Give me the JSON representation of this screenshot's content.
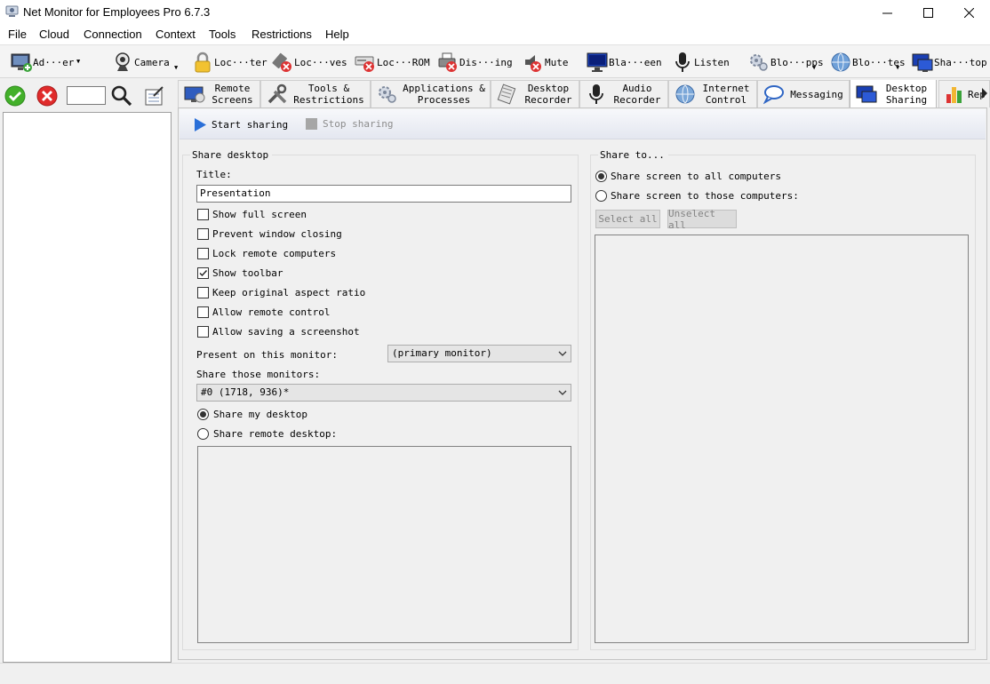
{
  "window": {
    "title": "Net Monitor for Employees Pro 6.7.3"
  },
  "menu": [
    "File",
    "Cloud",
    "Connection",
    "Context",
    "Tools",
    "Restrictions",
    "Help"
  ],
  "toolbar": {
    "add": "Ad···er",
    "camera": "Camera",
    "lock": "Loc···ter",
    "lockdrives": "Loc···ves",
    "lockrom": "Loc···ROM",
    "disable": "Dis···ing",
    "mute": "Mute",
    "blackscreen": "Bla···een",
    "listen": "Listen",
    "blockapps": "Blo···pps",
    "blocksites": "Blo···tes",
    "shutdown": "Sha···top"
  },
  "tabs": [
    {
      "label": "Remote\nScreens"
    },
    {
      "label": "Tools &\nRestrictions"
    },
    {
      "label": "Applications &\nProcesses"
    },
    {
      "label": "Desktop\nRecorder"
    },
    {
      "label": "Audio\nRecorder"
    },
    {
      "label": "Internet\nControl"
    },
    {
      "label": "Messaging"
    },
    {
      "label": "Desktop\nSharing"
    },
    {
      "label": "Rep"
    }
  ],
  "actions": {
    "start": "Start sharing",
    "stop": "Stop sharing"
  },
  "share_desktop": {
    "group_title": "Share desktop",
    "title_label": "Title:",
    "title_value": "Presentation",
    "options": [
      {
        "label": "Show full screen",
        "checked": false
      },
      {
        "label": "Prevent window closing",
        "checked": false
      },
      {
        "label": "Lock remote computers",
        "checked": false
      },
      {
        "label": "Show toolbar",
        "checked": true
      },
      {
        "label": "Keep original aspect ratio",
        "checked": false
      },
      {
        "label": "Allow remote control",
        "checked": false
      },
      {
        "label": "Allow saving a screenshot",
        "checked": false
      }
    ],
    "monitor_label": "Present on this monitor:",
    "monitor_value": "(primary monitor)",
    "share_monitors_label": "Share those monitors:",
    "share_monitors_value": "#0 (1718, 936)*",
    "radio_my": "Share my desktop",
    "radio_remote": "Share remote desktop:",
    "selected_source": "my"
  },
  "share_to": {
    "group_title": "Share to...",
    "radio_all": "Share screen to all computers",
    "radio_those": "Share screen to those computers:",
    "selected": "all",
    "select_all": "Select all",
    "unselect_all": "Unselect all"
  }
}
